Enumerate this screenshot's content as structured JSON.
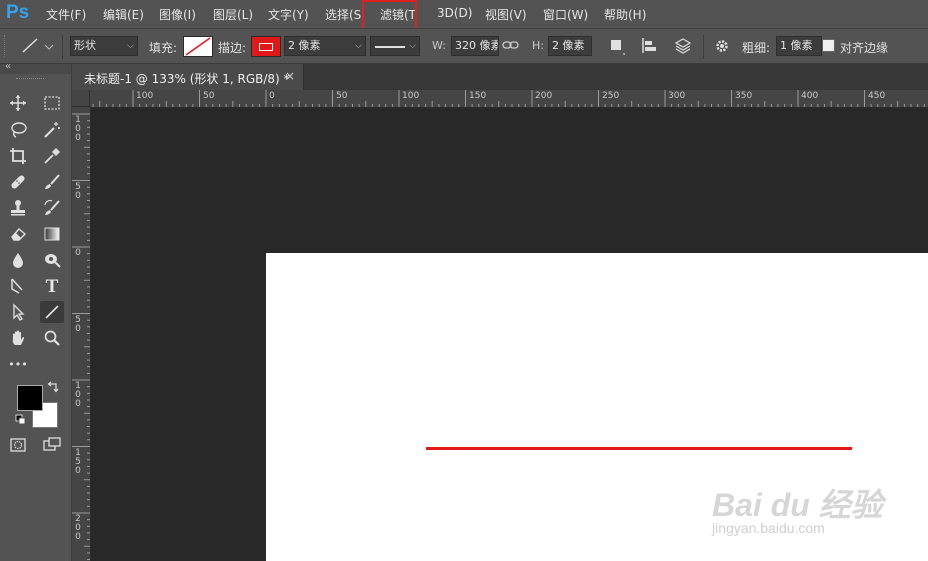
{
  "app": {
    "logo": "Ps"
  },
  "menu": [
    "文件(F)",
    "编辑(E)",
    "图像(I)",
    "图层(L)",
    "文字(Y)",
    "选择(S",
    "滤镜(T",
    "3D(D)",
    "视图(V)",
    "窗口(W)",
    "帮助(H)"
  ],
  "options": {
    "tool_mode": "形状",
    "fill_label": "填充:",
    "stroke_label": "描边:",
    "stroke_width": "2 像素",
    "w_label": "W:",
    "w_value": "320 像素",
    "h_label": "H:",
    "h_value": "2 像素",
    "weight_label": "粗细:",
    "weight_value": "1 像素",
    "align_edges_label": "对齐边缘",
    "align_edges_checked": false,
    "stroke_color": "#e01818"
  },
  "document": {
    "tab_title": "未标题-1 @ 133% (形状 1, RGB/8) *",
    "close_glyph": "×"
  },
  "ruler_top_labels": [
    "100",
    "50",
    "0",
    "50",
    "100",
    "150",
    "200",
    "250",
    "300",
    "350",
    "400",
    "450"
  ],
  "ruler_left_labels": [
    "100",
    "50",
    "0",
    "50",
    "100",
    "150",
    "200"
  ],
  "toolbox": {
    "collapse_glyph": "«",
    "tools": [
      "move-tool-icon",
      "marquee-tool-icon",
      "lasso-tool-icon",
      "magic-wand-tool-icon",
      "crop-tool-icon",
      "eyedropper-tool-icon",
      "healing-brush-tool-icon",
      "brush-tool-icon",
      "clone-stamp-tool-icon",
      "history-brush-tool-icon",
      "eraser-tool-icon",
      "gradient-tool-icon",
      "blur-tool-icon",
      "dodge-tool-icon",
      "pen-tool-icon",
      "type-tool-icon",
      "path-selection-tool-icon",
      "line-tool-icon",
      "hand-tool-icon",
      "zoom-tool-icon",
      "more-tools-icon"
    ],
    "type_glyph": "T",
    "more_glyph": "•••",
    "foreground_color": "#000000",
    "background_color": "#ffffff"
  },
  "watermark": {
    "logo": "Bai du 经验",
    "url": "jingyan.baidu.com"
  }
}
